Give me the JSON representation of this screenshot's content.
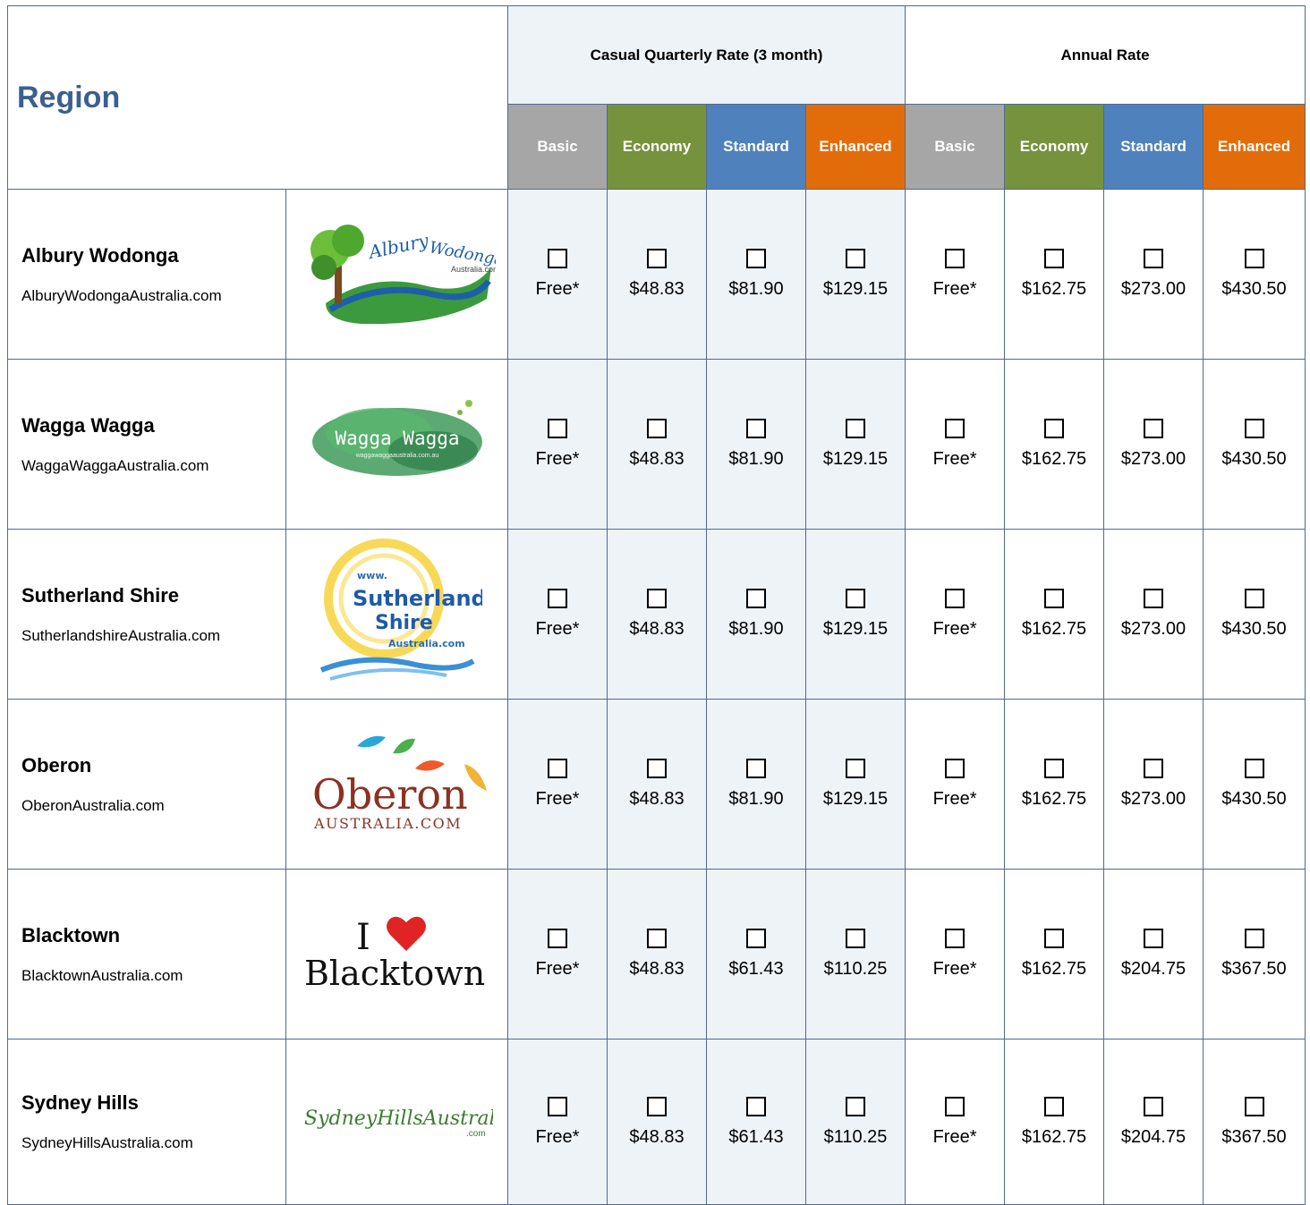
{
  "header": {
    "region_label": "Region",
    "quarterly_label": "Casual Quarterly Rate (3 month)",
    "annual_label": "Annual Rate",
    "tiers": [
      "Basic",
      "Economy",
      "Standard",
      "Enhanced"
    ]
  },
  "colors": {
    "basic": "#a6a6a6",
    "economy": "#76923c",
    "standard": "#4f81bd",
    "enhanced": "#e36c0a",
    "region_title": "#3b5f90",
    "light_column": "#eef3f8"
  },
  "rows": [
    {
      "name": "Albury Wodonga",
      "site": "AlburyWodongaAustralia.com",
      "logo_text": "Albury Wodonga Australia.com",
      "quarterly": [
        "Free*",
        "$48.83",
        "$81.90",
        "$129.15"
      ],
      "annual": [
        "Free*",
        "$162.75",
        "$273.00",
        "$430.50"
      ]
    },
    {
      "name": "Wagga Wagga",
      "site": "WaggaWaggaAustralia.com",
      "logo_text": "Wagga Wagga",
      "logo_sub": "waggawaggaaustralia.com.au",
      "quarterly": [
        "Free*",
        "$48.83",
        "$81.90",
        "$129.15"
      ],
      "annual": [
        "Free*",
        "$162.75",
        "$273.00",
        "$430.50"
      ]
    },
    {
      "name": "Sutherland Shire",
      "site": "SutherlandshireAustralia.com",
      "logo_text": "Sutherland Shire",
      "logo_www": "www.",
      "logo_sub": "Australia.com",
      "quarterly": [
        "Free*",
        "$48.83",
        "$81.90",
        "$129.15"
      ],
      "annual": [
        "Free*",
        "$162.75",
        "$273.00",
        "$430.50"
      ]
    },
    {
      "name": "Oberon",
      "site": "OberonAustralia.com",
      "logo_text": "Oberon",
      "logo_sub": "AUSTRALIA.COM",
      "quarterly": [
        "Free*",
        "$48.83",
        "$81.90",
        "$129.15"
      ],
      "annual": [
        "Free*",
        "$162.75",
        "$273.00",
        "$430.50"
      ]
    },
    {
      "name": "Blacktown",
      "site": "BlacktownAustralia.com",
      "logo_text": "Blacktown",
      "logo_i": "I",
      "quarterly": [
        "Free*",
        "$48.83",
        "$61.43",
        "$110.25"
      ],
      "annual": [
        "Free*",
        "$162.75",
        "$204.75",
        "$367.50"
      ]
    },
    {
      "name": "Sydney Hills",
      "site": "SydneyHillsAustralia.com",
      "logo_text": "SydneyHillsAustralia",
      "logo_sub": ".com",
      "quarterly": [
        "Free*",
        "$48.83",
        "$61.43",
        "$110.25"
      ],
      "annual": [
        "Free*",
        "$162.75",
        "$204.75",
        "$367.50"
      ]
    }
  ]
}
